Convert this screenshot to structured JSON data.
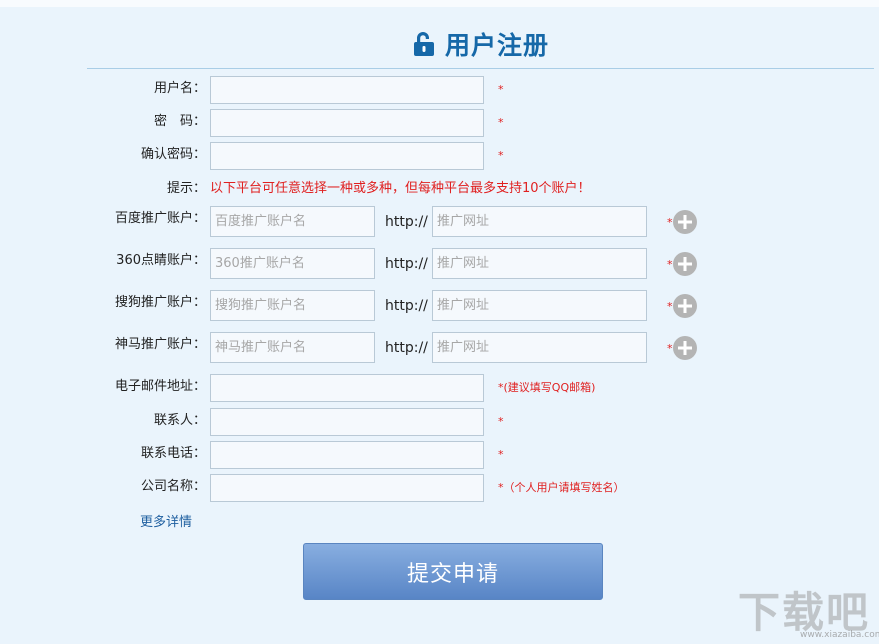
{
  "header": {
    "title": "用户注册",
    "icon": "lock-open-icon",
    "accent": "#1668a8"
  },
  "fields": {
    "username": {
      "label": "用户名：",
      "value": "",
      "required": "*"
    },
    "password": {
      "label": "密　码：",
      "value": "",
      "required": "*"
    },
    "confirm": {
      "label": "确认密码：",
      "value": "",
      "required": "*"
    }
  },
  "hint": {
    "label": "提示：",
    "text": "以下平台可任意选择一种或多种，但每种平台最多支持10个账户！",
    "color": "#e02020"
  },
  "accounts": [
    {
      "label": "百度推广账户：",
      "name_placeholder": "百度推广账户名",
      "http": "http://",
      "url_placeholder": "推广网址",
      "required": "*"
    },
    {
      "label": "360点睛账户：",
      "name_placeholder": "360推广账户名",
      "http": "http://",
      "url_placeholder": "推广网址",
      "required": "*"
    },
    {
      "label": "搜狗推广账户：",
      "name_placeholder": "搜狗推广账户名",
      "http": "http://",
      "url_placeholder": "推广网址",
      "required": "*"
    },
    {
      "label": "神马推广账户：",
      "name_placeholder": "神马推广账户名",
      "http": "http://",
      "url_placeholder": "推广网址",
      "required": "*"
    }
  ],
  "contact": {
    "email": {
      "label": "电子邮件地址：",
      "value": "",
      "note": "*(建议填写QQ邮箱)"
    },
    "person": {
      "label": "联系人：",
      "value": "",
      "required": "*"
    },
    "phone": {
      "label": "联系电话：",
      "value": "",
      "required": "*"
    },
    "company": {
      "label": "公司名称：",
      "value": "",
      "note": "*（个人用户请填写姓名）"
    }
  },
  "more_link": "更多详情",
  "submit_label": "提交申请",
  "watermark": {
    "text": "下载吧",
    "sub": "www.xiazaiba.com"
  }
}
